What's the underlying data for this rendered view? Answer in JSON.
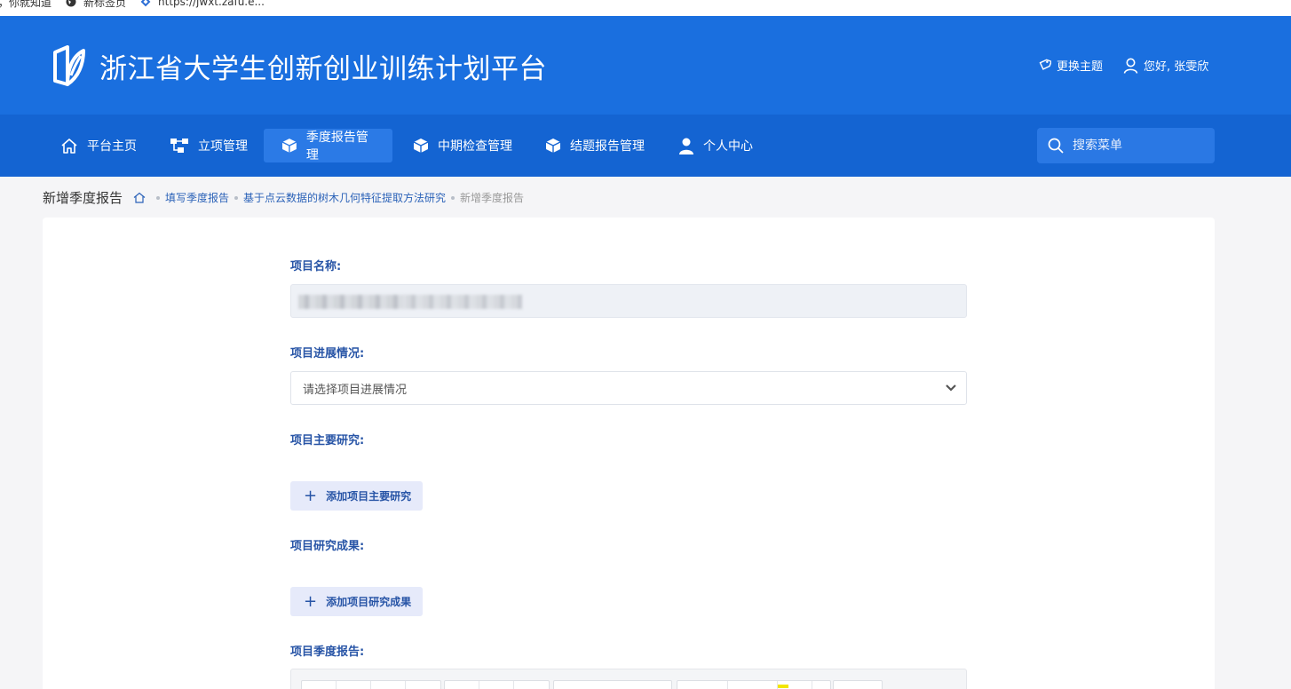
{
  "bookmarks": [
    {
      "label": "，你就知道",
      "icon": "none-icon"
    },
    {
      "label": "新标签页",
      "icon": "globe-icon"
    },
    {
      "label": "https://jwxt.zafu.e...",
      "icon": "link-icon"
    }
  ],
  "header": {
    "title": "浙江省大学生创新创业训练计划平台",
    "theme_label": "更换主题",
    "user_greeting": "您好, 张雯欣"
  },
  "nav": {
    "items": [
      {
        "label": "平台主页",
        "icon": "home-icon",
        "active": false
      },
      {
        "label": "立项管理",
        "icon": "hierarchy-icon",
        "active": false
      },
      {
        "label": "季度报告管理",
        "icon": "box-icon",
        "active": true
      },
      {
        "label": "中期检查管理",
        "icon": "box-icon",
        "active": false
      },
      {
        "label": "结题报告管理",
        "icon": "box-icon",
        "active": false
      },
      {
        "label": "个人中心",
        "icon": "person-icon",
        "active": false
      }
    ],
    "search_placeholder": "搜索菜单"
  },
  "breadcrumb": {
    "page_title": "新增季度报告",
    "links": [
      "填写季度报告",
      "基于点云数据的树木几何特征提取方法研究"
    ],
    "current": "新增季度报告"
  },
  "form": {
    "project_name_label": "项目名称:",
    "progress_label": "项目进展情况:",
    "progress_placeholder": "请选择项目进展情况",
    "main_research_label": "项目主要研究:",
    "add_main_research": "添加项目主要研究",
    "results_label": "项目研究成果:",
    "add_results": "添加项目研究成果",
    "quarterly_report_label": "项目季度报告:"
  },
  "colors": {
    "header_bg": "#1a6fdf",
    "nav_bg": "#1464d2",
    "label_blue": "#2754a6"
  }
}
